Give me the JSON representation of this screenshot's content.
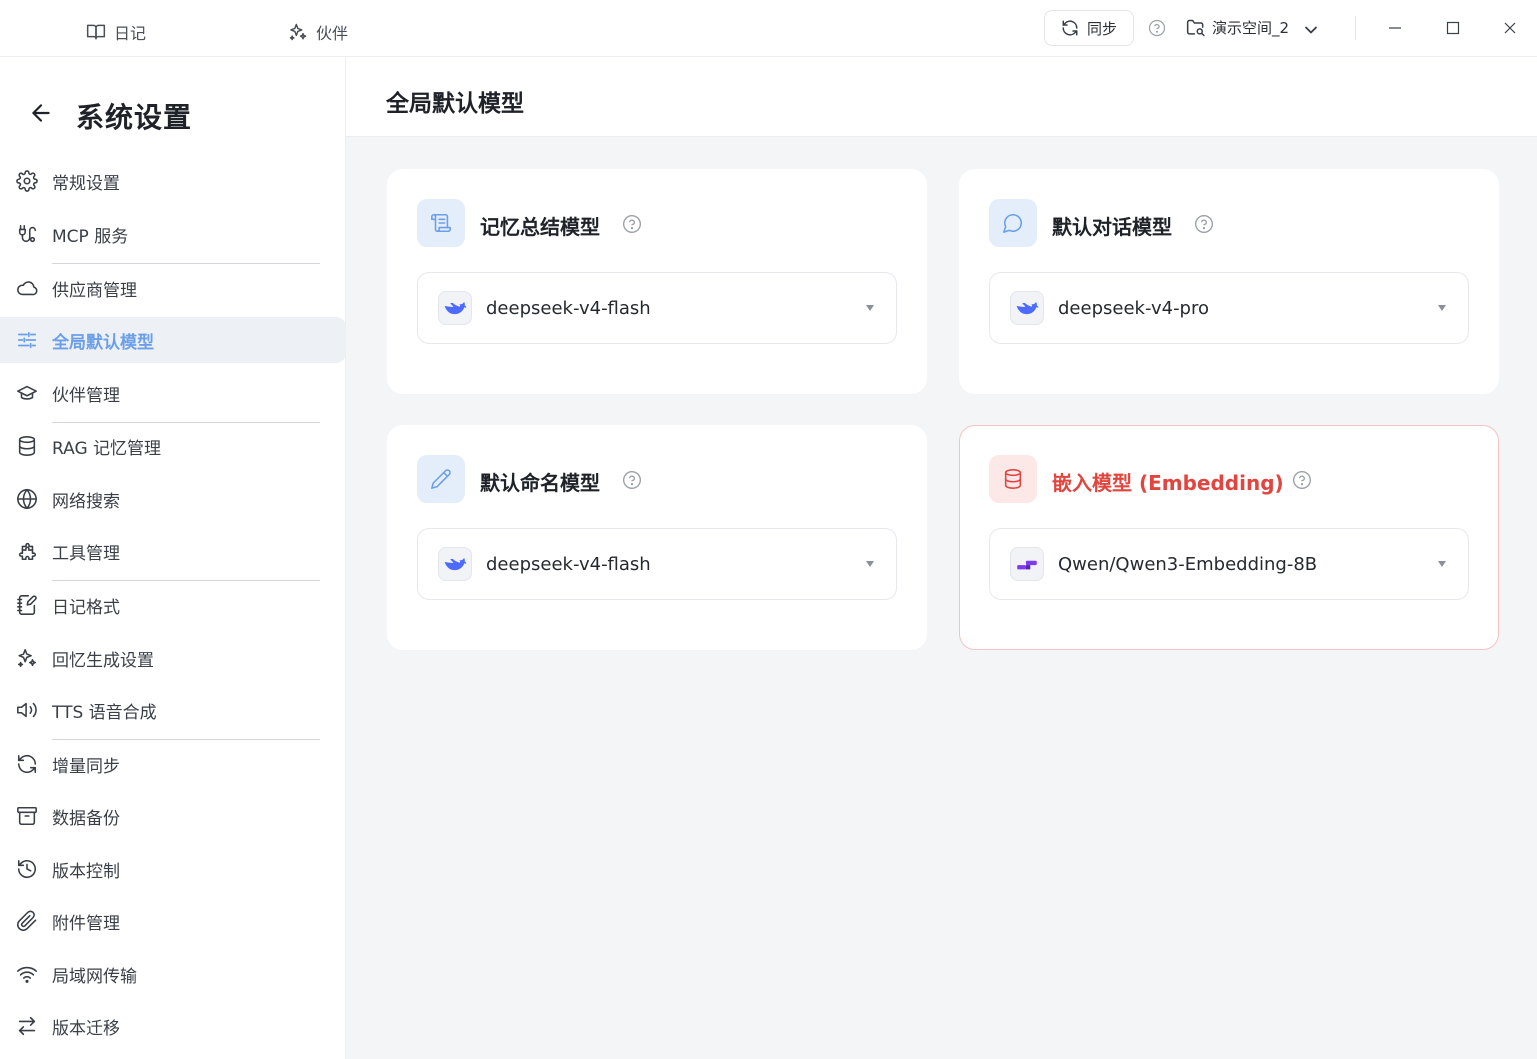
{
  "topbar": {
    "tabs": [
      {
        "label": "日记",
        "icon": "book-icon"
      },
      {
        "label": "伙伴",
        "icon": "sparkles-icon"
      }
    ],
    "sync_label": "同步",
    "workspace": "演示空间_2"
  },
  "sidebar": {
    "title": "系统设置",
    "items": [
      {
        "label": "常规设置",
        "icon": "gear-icon"
      },
      {
        "label": "MCP 服务",
        "icon": "plug-route-icon"
      },
      {
        "label": "供应商管理",
        "icon": "cloud-icon"
      },
      {
        "label": "全局默认模型",
        "icon": "sliders-icon",
        "active": true
      },
      {
        "label": "伙伴管理",
        "icon": "graduation-cap-icon"
      },
      {
        "label": "RAG 记忆管理",
        "icon": "database-icon"
      },
      {
        "label": "网络搜索",
        "icon": "globe-icon"
      },
      {
        "label": "工具管理",
        "icon": "puzzle-icon"
      },
      {
        "label": "日记格式",
        "icon": "notebook-pen-icon"
      },
      {
        "label": "回忆生成设置",
        "icon": "sparkles-icon"
      },
      {
        "label": "TTS 语音合成",
        "icon": "speaker-icon"
      },
      {
        "label": "增量同步",
        "icon": "refresh-icon"
      },
      {
        "label": "数据备份",
        "icon": "archive-icon"
      },
      {
        "label": "版本控制",
        "icon": "history-icon"
      },
      {
        "label": "附件管理",
        "icon": "paperclip-icon"
      },
      {
        "label": "局域网传输",
        "icon": "wifi-icon"
      },
      {
        "label": "版本迁移",
        "icon": "swap-arrows-icon"
      }
    ]
  },
  "main": {
    "title": "全局默认模型",
    "cards": [
      {
        "title": "记忆总结模型",
        "icon": "scroll-icon",
        "model": "deepseek-v4-flash",
        "model_logo": "deepseek-logo"
      },
      {
        "title": "默认对话模型",
        "icon": "chat-bubble-icon",
        "model": "deepseek-v4-pro",
        "model_logo": "deepseek-logo"
      },
      {
        "title": "默认命名模型",
        "icon": "pencil-icon",
        "model": "deepseek-v4-flash",
        "model_logo": "deepseek-logo"
      },
      {
        "title": "嵌入模型 (Embedding)",
        "icon": "database-icon",
        "model": "Qwen/Qwen3-Embedding-8B",
        "model_logo": "siliconflow-logo",
        "highlight": true
      }
    ]
  },
  "colors": {
    "accent": "#6b9fe8",
    "danger": "#e0453f",
    "deepseek": "#4d6bfe",
    "embed_logo": "#7c3aed"
  }
}
